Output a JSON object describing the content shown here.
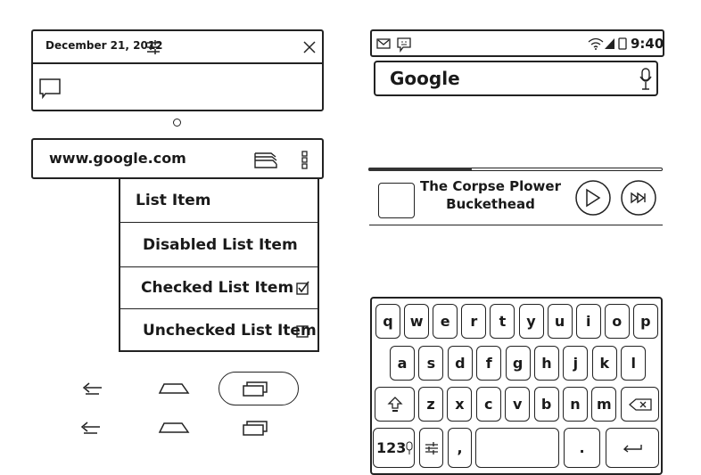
{
  "notification": {
    "date": "December 21, 2012",
    "settings_icon": "sliders-icon",
    "close_icon": "close-icon",
    "message_icon": "chat-bubble-icon"
  },
  "url_bar": {
    "url": "www.google.com",
    "tabs_icon": "tabs-icon",
    "menu_icon": "overflow-menu-icon"
  },
  "menu": {
    "items": [
      {
        "label": "List Item",
        "state": "normal"
      },
      {
        "label": "Disabled List Item",
        "state": "disabled"
      },
      {
        "label": "Checked List Item",
        "state": "checked"
      },
      {
        "label": "Unchecked List Item",
        "state": "unchecked"
      }
    ]
  },
  "status_bar": {
    "time": "9:40",
    "left_icons": [
      "gmail-icon",
      "messenger-icon"
    ],
    "right_icons": [
      "wifi-icon",
      "signal-icon",
      "battery-icon"
    ]
  },
  "search": {
    "text": "Google",
    "mic_icon": "microphone-icon"
  },
  "player": {
    "title": "The Corpse Plower",
    "artist": "Buckethead",
    "progress": 0.35
  },
  "keyboard": {
    "row1": [
      "q",
      "w",
      "e",
      "r",
      "t",
      "y",
      "u",
      "i",
      "o",
      "p"
    ],
    "row2": [
      "a",
      "s",
      "d",
      "f",
      "g",
      "h",
      "j",
      "k",
      "l"
    ],
    "row3": [
      "z",
      "x",
      "c",
      "v",
      "b",
      "n",
      "m"
    ],
    "numbers_key": "123",
    "comma": ",",
    "period": "."
  }
}
